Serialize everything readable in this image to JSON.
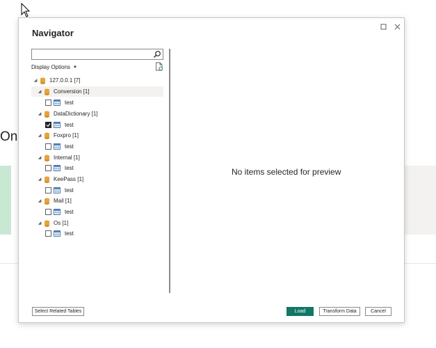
{
  "background": {
    "partial_text": "On"
  },
  "dialog": {
    "title": "Navigator",
    "window_controls": {
      "maximize_icon": "maximize-icon",
      "close_icon": "close-icon"
    },
    "search": {
      "value": "",
      "placeholder": ""
    },
    "display_options_label": "Display Options",
    "tree": {
      "root": {
        "label": "127.0.0.1 [7]",
        "expanded": true
      },
      "databases": [
        {
          "label": "Conversion [1]",
          "expanded": true,
          "selected": true,
          "tables": [
            {
              "label": "test",
              "checked": false
            }
          ]
        },
        {
          "label": "DataDictionary [1]",
          "expanded": true,
          "tables": [
            {
              "label": "test",
              "checked": true
            }
          ]
        },
        {
          "label": "Foxpro [1]",
          "expanded": true,
          "tables": [
            {
              "label": "test",
              "checked": false
            }
          ]
        },
        {
          "label": "Internal [1]",
          "expanded": true,
          "tables": [
            {
              "label": "test",
              "checked": false
            }
          ]
        },
        {
          "label": "KeePass [1]",
          "expanded": true,
          "tables": [
            {
              "label": "test",
              "checked": false
            }
          ]
        },
        {
          "label": "Mail [1]",
          "expanded": true,
          "tables": [
            {
              "label": "test",
              "checked": false
            }
          ]
        },
        {
          "label": "Os [1]",
          "expanded": true,
          "tables": [
            {
              "label": "test",
              "checked": false
            }
          ]
        }
      ]
    },
    "preview_message": "No items selected for preview",
    "buttons": {
      "select_related": "Select Related Tables",
      "load": "Load",
      "transform": "Transform Data",
      "cancel": "Cancel"
    },
    "colors": {
      "accent": "#117865",
      "selection": "#f3f2f1",
      "db_icon": "#e8a33d"
    }
  }
}
